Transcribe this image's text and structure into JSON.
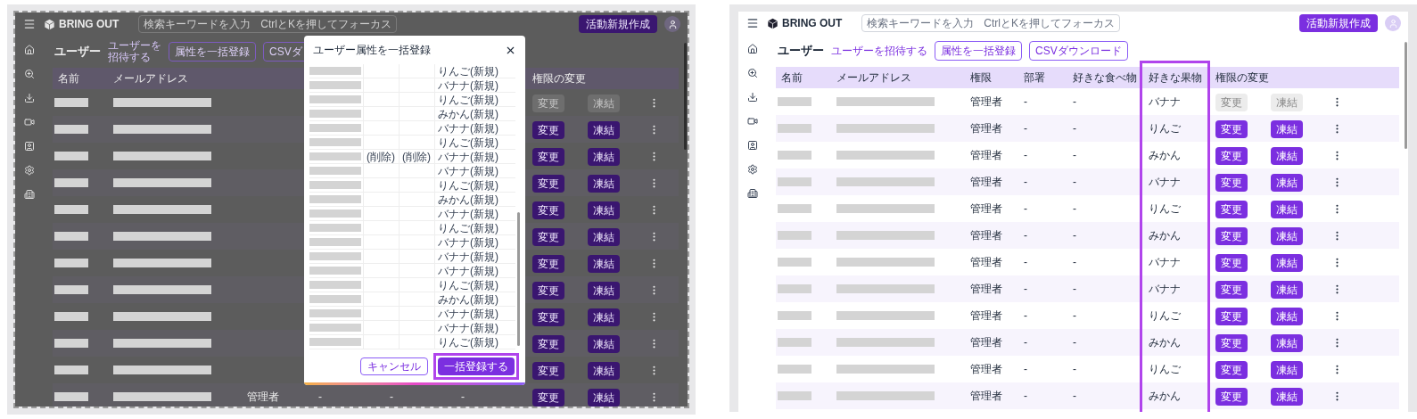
{
  "screens": [
    {
      "kind": "dialog",
      "topbar": {
        "logo": "BRING OUT",
        "search": {
          "placeholder": "検索キーワードを入力",
          "hint": "CtrlとKを押してフォーカス"
        },
        "create_button": "活動新規作成"
      },
      "page": {
        "title": "ユーザー",
        "invite_link": "ユーザーを招待する",
        "buttons": [
          "属性を一括登録",
          "CSVダ"
        ]
      },
      "table": {
        "columns": [
          {
            "kind": "name",
            "label": "名前"
          },
          {
            "kind": "email",
            "label": "メールアドレス"
          },
          {
            "kind": "actions",
            "label": "権限の変更"
          }
        ],
        "rows": [
          {
            "disabled": true,
            "change": "変更",
            "freeze": "凍結"
          },
          {
            "disabled": false,
            "change": "変更",
            "freeze": "凍結"
          },
          {
            "disabled": false,
            "change": "変更",
            "freeze": "凍結"
          },
          {
            "disabled": false,
            "change": "変更",
            "freeze": "凍結"
          },
          {
            "disabled": false,
            "change": "変更",
            "freeze": "凍結"
          },
          {
            "disabled": false,
            "change": "変更",
            "freeze": "凍結"
          },
          {
            "disabled": false,
            "change": "変更",
            "freeze": "凍結"
          },
          {
            "disabled": false,
            "change": "変更",
            "freeze": "凍結"
          },
          {
            "disabled": false,
            "change": "変更",
            "freeze": "凍結"
          },
          {
            "disabled": false,
            "change": "変更",
            "freeze": "凍結"
          },
          {
            "disabled": false,
            "change": "変更",
            "freeze": "凍結"
          },
          {
            "disabled": false,
            "change": "変更",
            "freeze": "凍結",
            "role": "管理者",
            "department": "-",
            "food": "-",
            "fruit": "-"
          }
        ]
      },
      "dialog": {
        "title": "ユーザー属性を一括登録",
        "rows": [
          {
            "column_4": "りんご(新規)"
          },
          {
            "column_4": "バナナ(新規)"
          },
          {
            "column_4": "りんご(新規)"
          },
          {
            "column_4": "みかん(新規)"
          },
          {
            "column_4": "バナナ(新規)"
          },
          {
            "column_4": "りんご(新規)"
          },
          {
            "column_2": "(削除)",
            "column_3": "(削除)",
            "column_4": "バナナ(新規)"
          },
          {
            "column_4": "バナナ(新規)"
          },
          {
            "column_4": "りんご(新規)"
          },
          {
            "column_4": "みかん(新規)"
          },
          {
            "column_4": "バナナ(新規)"
          },
          {
            "column_4": "りんご(新規)"
          },
          {
            "column_4": "バナナ(新規)"
          },
          {
            "column_4": "バナナ(新規)"
          },
          {
            "column_4": "バナナ(新規)"
          },
          {
            "column_4": "りんご(新規)"
          },
          {
            "column_4": "みかん(新規)"
          },
          {
            "column_4": "バナナ(新規)"
          },
          {
            "column_4": "バナナ(新規)"
          },
          {
            "column_4": "りんご(新規)"
          }
        ],
        "cancel": "キャンセル",
        "submit": {
          "label": "一括登録する",
          "highlighted": true
        }
      }
    },
    {
      "kind": "table",
      "topbar": {
        "logo": "BRING OUT",
        "search": {
          "placeholder": "検索キーワードを入力",
          "hint": "CtrlとKを押してフォーカス"
        },
        "create_button": "活動新規作成"
      },
      "page": {
        "title": "ユーザー",
        "invite_link": "ユーザーを招待する",
        "buttons": [
          "属性を一括登録",
          "CSVダウンロード"
        ]
      },
      "table": {
        "columns": [
          {
            "kind": "name",
            "label": "名前"
          },
          {
            "kind": "email",
            "label": "メールアドレス"
          },
          {
            "kind": "role",
            "label": "権限"
          },
          {
            "kind": "department",
            "label": "部署"
          },
          {
            "kind": "food",
            "label": "好きな食べ物"
          },
          {
            "kind": "fruit",
            "label": "好きな果物",
            "highlighted": true
          },
          {
            "kind": "actions",
            "label": "権限の変更"
          }
        ],
        "rows": [
          {
            "disabled": true,
            "change": "変更",
            "freeze": "凍結",
            "role": "管理者",
            "department": "-",
            "food": "-",
            "fruit": "バナナ"
          },
          {
            "disabled": false,
            "change": "変更",
            "freeze": "凍結",
            "role": "管理者",
            "department": "-",
            "food": "-",
            "fruit": "りんご"
          },
          {
            "disabled": false,
            "change": "変更",
            "freeze": "凍結",
            "role": "管理者",
            "department": "-",
            "food": "-",
            "fruit": "みかん"
          },
          {
            "disabled": false,
            "change": "変更",
            "freeze": "凍結",
            "role": "管理者",
            "department": "-",
            "food": "-",
            "fruit": "バナナ"
          },
          {
            "disabled": false,
            "change": "変更",
            "freeze": "凍結",
            "role": "管理者",
            "department": "-",
            "food": "-",
            "fruit": "りんご"
          },
          {
            "disabled": false,
            "change": "変更",
            "freeze": "凍結",
            "role": "管理者",
            "department": "-",
            "food": "-",
            "fruit": "みかん"
          },
          {
            "disabled": false,
            "change": "変更",
            "freeze": "凍結",
            "role": "管理者",
            "department": "-",
            "food": "-",
            "fruit": "バナナ"
          },
          {
            "disabled": false,
            "change": "変更",
            "freeze": "凍結",
            "role": "管理者",
            "department": "-",
            "food": "-",
            "fruit": "バナナ"
          },
          {
            "disabled": false,
            "change": "変更",
            "freeze": "凍結",
            "role": "管理者",
            "department": "-",
            "food": "-",
            "fruit": "りんご"
          },
          {
            "disabled": false,
            "change": "変更",
            "freeze": "凍結",
            "role": "管理者",
            "department": "-",
            "food": "-",
            "fruit": "みかん"
          },
          {
            "disabled": false,
            "change": "変更",
            "freeze": "凍結",
            "role": "管理者",
            "department": "-",
            "food": "-",
            "fruit": "りんご"
          },
          {
            "disabled": false,
            "change": "変更",
            "freeze": "凍結",
            "role": "管理者",
            "department": "-",
            "food": "-",
            "fruit": "みかん"
          }
        ]
      }
    }
  ]
}
